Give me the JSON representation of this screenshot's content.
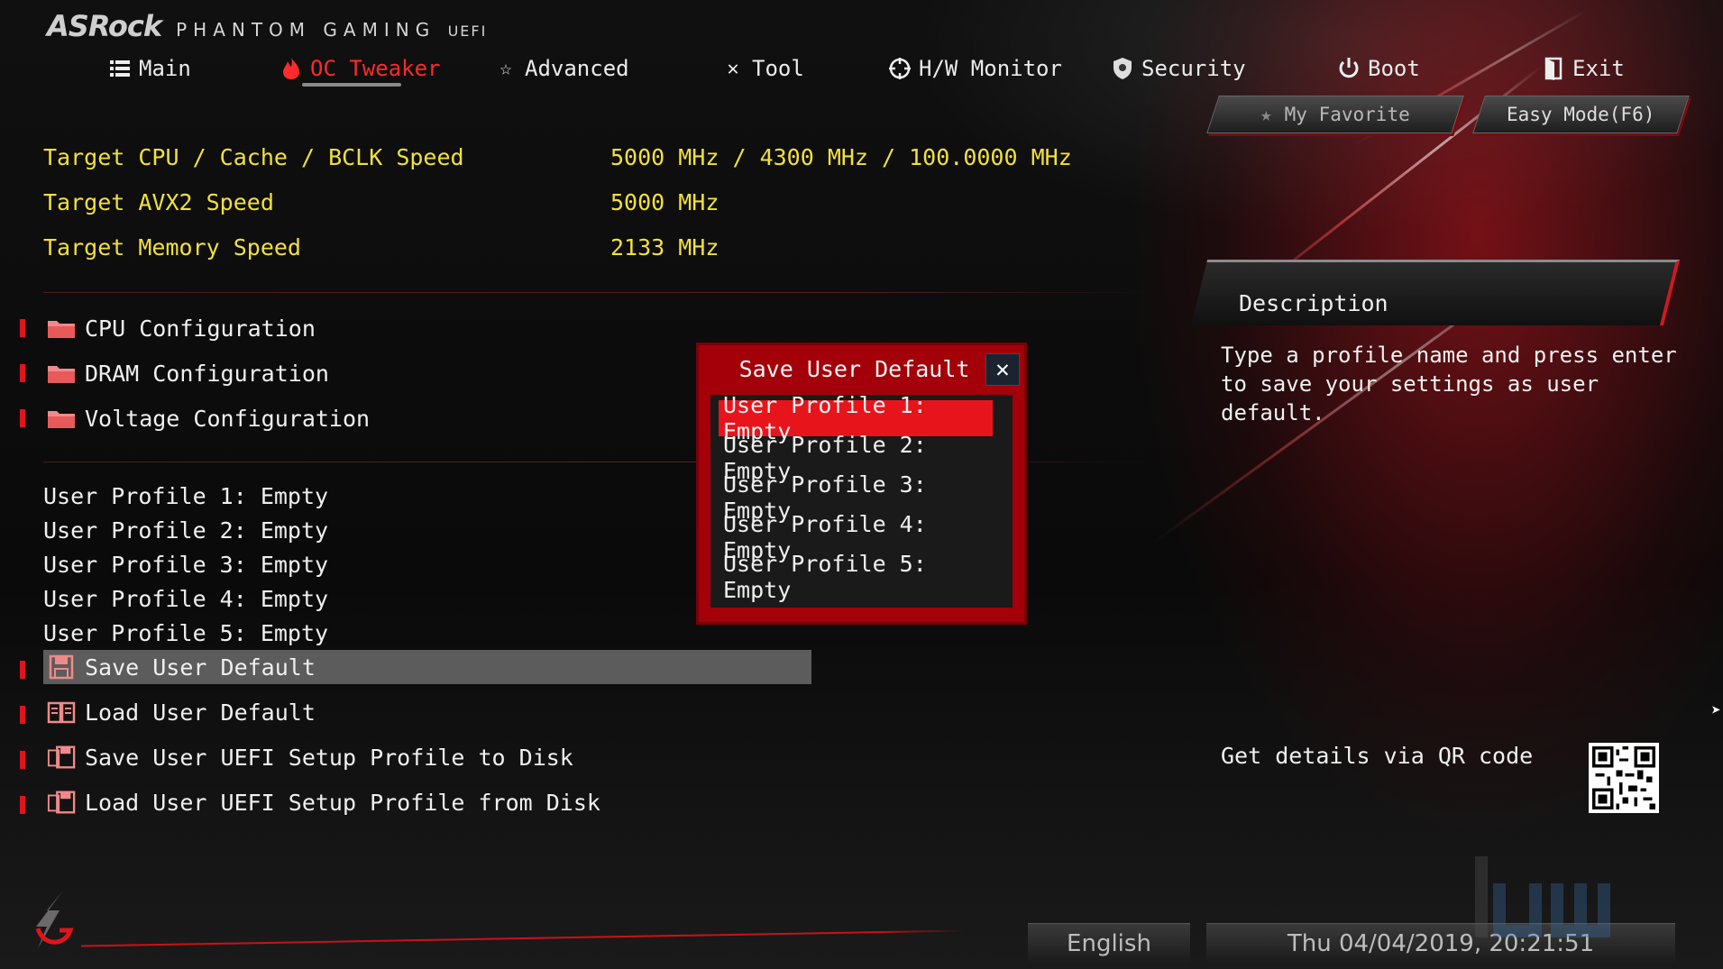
{
  "logo": {
    "brand": "ASRock",
    "sub": "PHANTOM GAMING",
    "sub2": "UEFI"
  },
  "nav": {
    "tabs": [
      {
        "label": "Main",
        "icon": "list-icon"
      },
      {
        "label": "OC Tweaker",
        "icon": "flame-icon",
        "active": true
      },
      {
        "label": "Advanced",
        "icon": "star-icon"
      },
      {
        "label": "Tool",
        "icon": "tools-icon"
      },
      {
        "label": "H/W Monitor",
        "icon": "crosshair-icon"
      },
      {
        "label": "Security",
        "icon": "shield-icon"
      },
      {
        "label": "Boot",
        "icon": "power-icon"
      },
      {
        "label": "Exit",
        "icon": "exit-icon"
      }
    ]
  },
  "buttons": {
    "favorite": "My Favorite",
    "easy_mode": "Easy Mode(F6)"
  },
  "info": [
    {
      "label": "Target CPU / Cache / BCLK Speed",
      "value": "5000 MHz / 4300 MHz / 100.0000 MHz"
    },
    {
      "label": "Target AVX2 Speed",
      "value": "5000 MHz"
    },
    {
      "label": "Target Memory Speed",
      "value": "2133 MHz"
    }
  ],
  "config_menu": [
    {
      "label": "CPU Configuration",
      "icon": "folder-icon"
    },
    {
      "label": "DRAM Configuration",
      "icon": "folder-icon"
    },
    {
      "label": "Voltage Configuration",
      "icon": "folder-icon"
    }
  ],
  "profiles": [
    "User Profile 1: Empty",
    "User Profile 2: Empty",
    "User Profile 3: Empty",
    "User Profile 4: Empty",
    "User Profile 5: Empty"
  ],
  "actions": [
    {
      "label": "Save User Default",
      "icon": "save-icon",
      "selected": true
    },
    {
      "label": "Load User Default",
      "icon": "book-icon"
    },
    {
      "label": "Save User UEFI Setup Profile to Disk",
      "icon": "save-disk-icon"
    },
    {
      "label": "Load User UEFI Setup Profile from Disk",
      "icon": "load-disk-icon"
    }
  ],
  "description": {
    "title": "Description",
    "body": "Type a profile name and press enter to save your settings as user default."
  },
  "qr": {
    "label": "Get details via QR code"
  },
  "dialog": {
    "title": "Save User Default",
    "items": [
      "User Profile 1: Empty",
      "User Profile 2: Empty",
      "User Profile 3: Empty",
      "User Profile 4: Empty",
      "User Profile 5: Empty"
    ],
    "selected_index": 0
  },
  "status": {
    "language": "English",
    "datetime": "Thu 04/04/2019, 20:21:51"
  },
  "colors": {
    "accent_red": "#e8141c",
    "value_yellow": "#f2e13a",
    "dialog_red": "#a3000a"
  }
}
